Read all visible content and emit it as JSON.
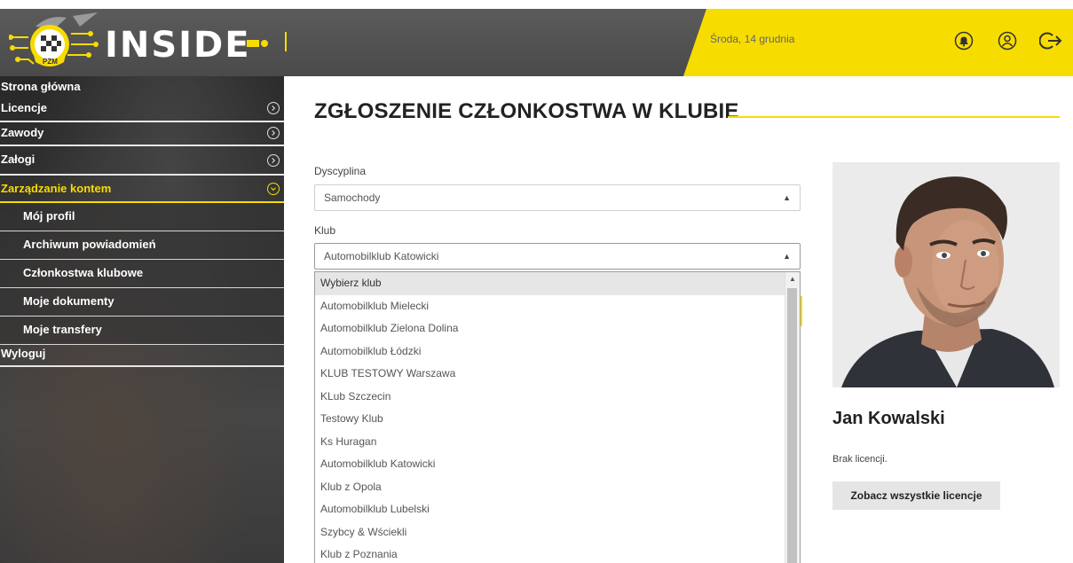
{
  "header": {
    "logo_text": "INSIDE",
    "logo_badge": "PZM",
    "date": "Środa, 14 grudnia",
    "icons": [
      "bell-icon",
      "user-circle-icon",
      "logout-icon"
    ],
    "accent": "#f7dc00",
    "bar_color": "#555555"
  },
  "sidebar": {
    "items": [
      {
        "label": "Strona główna"
      },
      {
        "label": "Licencje"
      },
      {
        "label": "Zawody"
      },
      {
        "label": "Załogi"
      },
      {
        "label": "Zarządzanie kontem"
      }
    ],
    "sub_items": [
      {
        "label": "Mój profil"
      },
      {
        "label": "Archiwum powiadomień"
      },
      {
        "label": "Członkostwa klubowe"
      },
      {
        "label": "Moje dokumenty"
      },
      {
        "label": "Moje transfery"
      }
    ],
    "logout": "Wyloguj"
  },
  "main": {
    "title": "ZGŁOSZENIE CZŁONKOSTWA W KLUBIE",
    "discipline": {
      "label": "Dyscyplina",
      "value": "Samochody"
    },
    "club": {
      "label": "Klub",
      "value": "Automobilklub Katowicki"
    },
    "options": [
      "Wybierz klub",
      "Automobilklub Mielecki",
      "Automobilklub Zielona Dolina",
      "Automobilklub Łódzki",
      "KLUB TESTOWY Warszawa",
      "KLub Szczecin",
      "Testowy Klub",
      "Ks Huragan",
      "Automobilklub Katowicki",
      "Klub z Opola",
      "Automobilklub Lubelski",
      "Szybcy & Wściekli",
      "Klub z Poznania"
    ]
  },
  "profile": {
    "name": "Jan Kowalski",
    "license_status": "Brak licencji.",
    "licenses_button": "Zobacz wszystkie licencje"
  }
}
